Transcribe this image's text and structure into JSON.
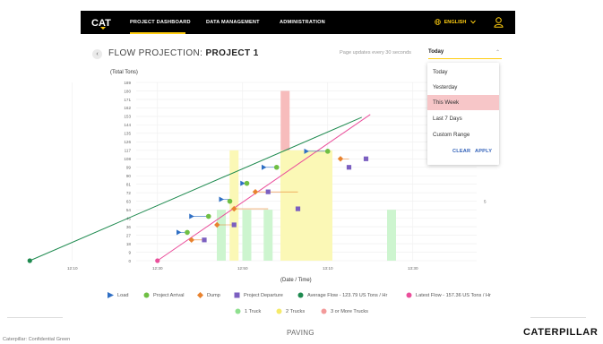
{
  "nav": {
    "logo_text": "CAT",
    "items": [
      {
        "label": "PROJECT DASHBOARD",
        "active": true
      },
      {
        "label": "DATA MANAGEMENT",
        "active": false
      },
      {
        "label": "ADMINISTRATION",
        "active": false
      }
    ],
    "language": "ENGLISH",
    "icons": [
      "globe-icon",
      "chevron-down-icon",
      "user-icon"
    ],
    "accent": "#ffcd11"
  },
  "header": {
    "title_prefix": "FLOW PROJECTION: ",
    "title_project": "PROJECT 1",
    "update_note": "Page updates every 30 seconds",
    "range_value": "Today"
  },
  "dropdown": {
    "options": [
      "Today",
      "Yesterday",
      "This Week",
      "Last 7 Days",
      "Custom Range"
    ],
    "highlighted": "This Week",
    "clear_label": "CLEAR",
    "apply_label": "APPLY"
  },
  "chart_data": {
    "type": "line",
    "ylabel": "(Total Tons)",
    "xlabel": "(Date / Time)",
    "y_ticks": [
      "189",
      "180",
      "171",
      "162",
      "153",
      "144",
      "135",
      "126",
      "117",
      "108",
      "99",
      "90",
      "81",
      "72",
      "63",
      "54",
      "45",
      "36",
      "27",
      "18",
      "9",
      "0"
    ],
    "x_ticks": [
      "12:10",
      "12:30",
      "12:50",
      "13:10",
      "13:30"
    ],
    "ylim": [
      0,
      189
    ],
    "right_tick": "5",
    "bars": [
      {
        "x": 12.45,
        "value": 54,
        "class": "1 Truck",
        "color": "#cdf5cf"
      },
      {
        "x": 12.48,
        "value": 117,
        "class": "2 Trucks",
        "color": "#fbf8b6"
      },
      {
        "x": 12.51,
        "value": 54,
        "class": "1 Truck",
        "color": "#cdf5cf"
      },
      {
        "x": 12.56,
        "value": 54,
        "class": "1 Truck",
        "color": "#cdf5cf"
      },
      {
        "x": 12.6,
        "value": 180,
        "class": "3 or More Trucks",
        "color": "#f7bcbc"
      },
      {
        "x": 13.05,
        "value": 117,
        "class": "2 Trucks",
        "color": "#fbf8b6"
      },
      {
        "x": 13.25,
        "value": 54,
        "class": "1 Truck",
        "color": "#cdf5cf"
      }
    ],
    "series": [
      {
        "name": "Load",
        "points": [
          [
            12.35,
            30
          ],
          [
            12.38,
            47
          ],
          [
            12.45,
            65
          ],
          [
            12.5,
            82
          ],
          [
            12.55,
            99
          ],
          [
            13.05,
            116
          ]
        ]
      },
      {
        "name": "Project Arrival",
        "points": [
          [
            12.0,
            0
          ],
          [
            12.37,
            30
          ],
          [
            12.42,
            47
          ],
          [
            12.47,
            63
          ],
          [
            12.51,
            82
          ],
          [
            12.58,
            99
          ],
          [
            13.1,
            116
          ]
        ]
      },
      {
        "name": "Dump",
        "points": [
          [
            12.38,
            22
          ],
          [
            12.44,
            38
          ],
          [
            12.48,
            55
          ],
          [
            12.53,
            73
          ],
          [
            13.13,
            108
          ]
        ]
      },
      {
        "name": "Project Departure",
        "points": [
          [
            12.41,
            22
          ],
          [
            12.48,
            38
          ],
          [
            12.56,
            73
          ],
          [
            13.03,
            55
          ],
          [
            13.15,
            99
          ],
          [
            13.19,
            108
          ]
        ]
      },
      {
        "name": "Average Flow - 123.79 US Tons / Hr",
        "points": [
          [
            12.0,
            0
          ],
          [
            13.18,
            152
          ]
        ]
      },
      {
        "name": "Latest Flow - 157.36 US Tons / Hr",
        "points": [
          [
            12.3,
            0
          ],
          [
            13.2,
            155
          ]
        ]
      }
    ]
  },
  "legend": {
    "items": [
      {
        "label": "Load",
        "color": "#2f6fc4",
        "shape": "triangle"
      },
      {
        "label": "Project Arrival",
        "color": "#6fbf44",
        "shape": "circle"
      },
      {
        "label": "Dump",
        "color": "#e8822e",
        "shape": "diamond"
      },
      {
        "label": "Project Departure",
        "color": "#7b5fc0",
        "shape": "square"
      },
      {
        "label": "Average Flow - 123.79 US Tons / Hr",
        "color": "#1e8a4f",
        "shape": "circle"
      },
      {
        "label": "Latest Flow - 157.36 US Tons / Hr",
        "color": "#ea4f9b",
        "shape": "circle"
      }
    ],
    "bar_items": [
      {
        "label": "1 Truck",
        "color": "#8fe08f"
      },
      {
        "label": "2 Trucks",
        "color": "#f5ea6a"
      },
      {
        "label": "3 or More Trucks",
        "color": "#f39a9a"
      }
    ]
  },
  "footer": {
    "confidential": "Caterpillar: Confidential Green",
    "section": "PAVING",
    "brand": "CATERPILLAR"
  }
}
